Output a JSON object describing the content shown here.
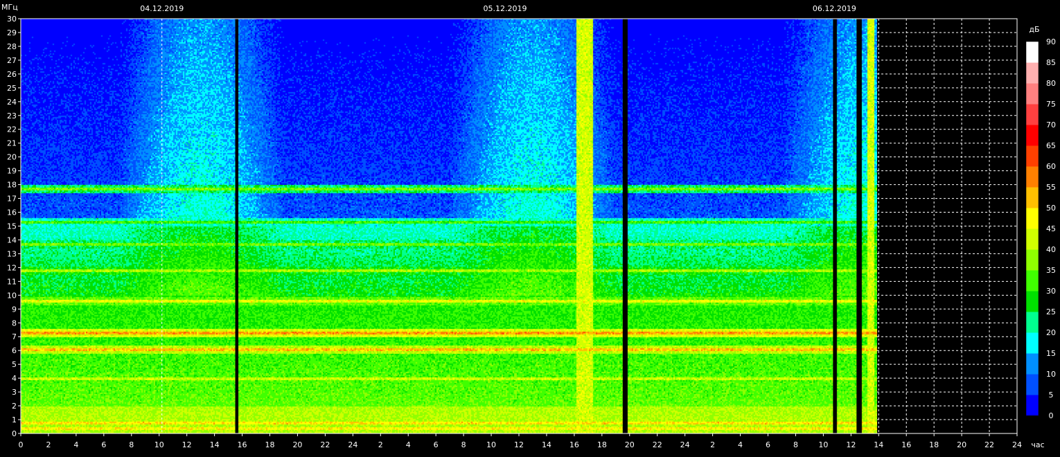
{
  "chart_data": {
    "type": "heatmap",
    "title": "",
    "ylabel": "МГц",
    "xlabel": "час",
    "colorbar_label": "дБ",
    "ylim": [
      0,
      30
    ],
    "y_ticks": [
      0,
      1,
      2,
      3,
      4,
      5,
      6,
      7,
      8,
      9,
      10,
      11,
      12,
      13,
      14,
      15,
      16,
      17,
      18,
      19,
      20,
      21,
      22,
      23,
      24,
      25,
      26,
      27,
      28,
      29,
      30
    ],
    "x_range_hours": [
      0,
      72
    ],
    "x_tick_step_hours": 2,
    "x_tick_labels": [
      "0",
      "2",
      "4",
      "6",
      "8",
      "10",
      "12",
      "14",
      "16",
      "18",
      "20",
      "22",
      "24",
      "2",
      "4",
      "6",
      "8",
      "10",
      "12",
      "14",
      "16",
      "18",
      "20",
      "22",
      "24",
      "2",
      "4",
      "6",
      "8",
      "10",
      "12",
      "14",
      "16",
      "18",
      "20",
      "22",
      "24"
    ],
    "day_labels": [
      {
        "text": "04.12.2019",
        "hour": 10.2
      },
      {
        "text": "05.12.2019",
        "hour": 35.0
      },
      {
        "text": "06.12.2019",
        "hour": 58.8
      }
    ],
    "day_boundaries_hours": [
      10.2
    ],
    "data_end_hour": 61.9,
    "gap_bands_hours": [
      [
        15.5,
        15.7
      ],
      [
        43.5,
        43.8
      ],
      [
        58.7,
        58.9
      ],
      [
        60.4,
        60.7
      ]
    ],
    "interference_bands_hours": [
      [
        40.1,
        41.3
      ],
      [
        61.1,
        61.6
      ]
    ],
    "colorbar": {
      "ticks": [
        0,
        5,
        10,
        15,
        20,
        25,
        30,
        35,
        40,
        45,
        50,
        55,
        60,
        65,
        70,
        75,
        80,
        85,
        90
      ],
      "colors": [
        "#0000ff",
        "#0050ff",
        "#0090ff",
        "#00ffff",
        "#00ff90",
        "#00e000",
        "#40ff00",
        "#90ff00",
        "#d0ff00",
        "#ffff00",
        "#ffc000",
        "#ff8000",
        "#ff4000",
        "#ff0000",
        "#ff4040",
        "#ff8080",
        "#ffb0b0",
        "#ffffff"
      ]
    },
    "signal_bands_mhz": [
      {
        "freq": 7.3,
        "level_db": 58
      },
      {
        "freq": 6.1,
        "level_db": 55
      },
      {
        "freq": 9.6,
        "level_db": 48
      },
      {
        "freq": 11.8,
        "level_db": 42
      },
      {
        "freq": 13.7,
        "level_db": 38
      },
      {
        "freq": 15.3,
        "level_db": 34
      },
      {
        "freq": 17.7,
        "level_db": 38
      },
      {
        "freq": 4.0,
        "level_db": 45
      },
      {
        "freq": 0.8,
        "level_db": 52
      },
      {
        "freq": 0.4,
        "level_db": 50
      }
    ],
    "grid": "dashed, only after data end"
  }
}
